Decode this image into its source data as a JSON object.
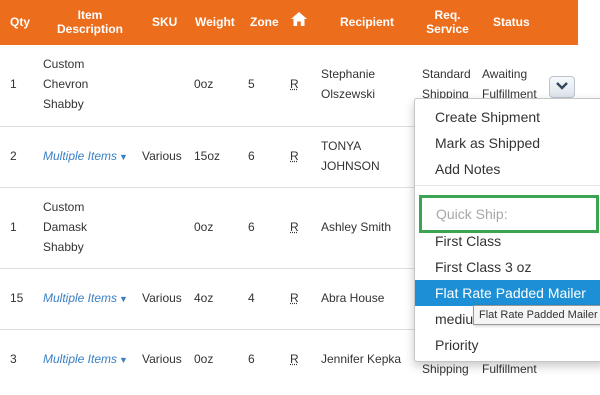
{
  "header": {
    "qty": "Qty",
    "item_l1": "Item",
    "item_l2": "Description",
    "sku": "SKU",
    "weight": "Weight",
    "zone": "Zone",
    "recipient": "Recipient",
    "req_l1": "Req.",
    "req_l2": "Service",
    "status": "Status",
    "home_icon": "home-icon"
  },
  "rows": [
    {
      "qty": "1",
      "desc": [
        "Custom",
        "Chevron",
        "Shabby"
      ],
      "sku": "",
      "weight": "0oz",
      "zone": "5",
      "r": "R",
      "recipient": [
        "Stephanie",
        "Olszewski"
      ],
      "service": [
        "Standard",
        "Shipping"
      ],
      "status": [
        "Awaiting",
        "Fulfillment"
      ]
    },
    {
      "qty": "2",
      "desc": "Multiple Items",
      "sku": "Various",
      "weight": "15oz",
      "zone": "6",
      "r": "R",
      "recipient": [
        "TONYA",
        "JOHNSON"
      ]
    },
    {
      "qty": "1",
      "desc": [
        "Custom",
        "Damask",
        "Shabby"
      ],
      "sku": "",
      "weight": "0oz",
      "zone": "6",
      "r": "R",
      "recipient": "Ashley Smith"
    },
    {
      "qty": "15",
      "desc": "Multiple Items",
      "sku": "Various",
      "weight": "4oz",
      "zone": "4",
      "r": "R",
      "recipient": "Abra House"
    },
    {
      "qty": "3",
      "desc": "Multiple Items",
      "sku": "Various",
      "weight": "0oz",
      "zone": "6",
      "r": "R",
      "recipient": "Jennifer Kepka",
      "service": "Shipping",
      "status": "Fulfillment"
    }
  ],
  "menu": {
    "create_shipment": "Create Shipment",
    "mark_shipped": "Mark as Shipped",
    "add_notes": "Add Notes",
    "quick_ship": "Quick Ship:",
    "first_class": "First Class",
    "first_class_3oz": "First Class 3 oz",
    "flat_rate": "Flat Rate Padded Mailer",
    "medium": "mediu",
    "priority": "Priority"
  },
  "tooltip": "Flat Rate Padded Mailer",
  "colors": {
    "header": "#ec6d1c",
    "link": "#3a7fc4",
    "highlight": "#1d8fd6",
    "quick_ship_border": "#3aa453"
  }
}
